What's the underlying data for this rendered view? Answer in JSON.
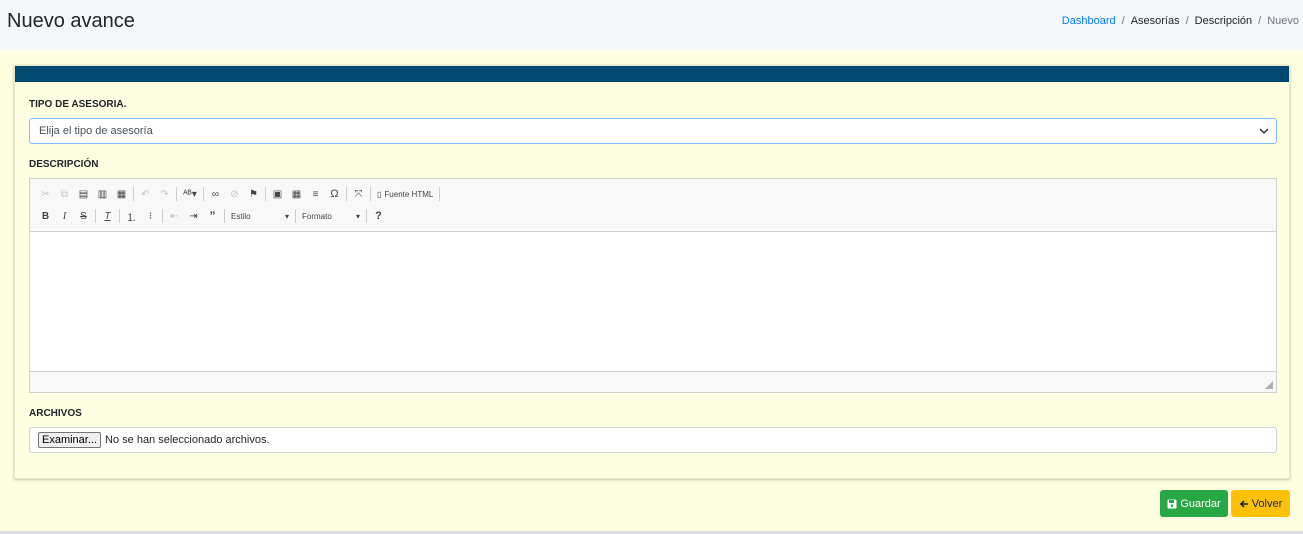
{
  "header": {
    "title": "Nuevo avance",
    "breadcrumb": [
      "Dashboard",
      "Asesorías",
      "Descripción",
      "Nuevo"
    ]
  },
  "form": {
    "tipo_label": "TIPO DE ASESORIA.",
    "tipo_select_value": "Elija el tipo de asesoría",
    "descripcion_label": "DESCRIPCIÓN",
    "archivos_label": "ARCHIVOS",
    "file_button": "Examinar...",
    "file_status": "No se han seleccionado archivos."
  },
  "editor": {
    "source_label": "Fuente HTML",
    "style_combo": "Estilo",
    "format_combo": "Formato",
    "help": "?",
    "row1_icons": [
      "cut-icon",
      "copy-icon",
      "paste-icon",
      "paste-text-icon",
      "paste-word-icon",
      "undo-icon",
      "redo-icon",
      "spellcheck-icon",
      "link-icon",
      "unlink-icon",
      "anchor-icon",
      "image-icon",
      "table-icon",
      "horizontal-rule-icon",
      "special-char-icon",
      "maximize-icon",
      "source-icon"
    ],
    "row2_icons": [
      "bold-icon",
      "italic-icon",
      "strike-icon",
      "remove-format-icon",
      "numbered-list-icon",
      "bulleted-list-icon",
      "outdent-icon",
      "indent-icon",
      "blockquote-icon",
      "help-icon"
    ]
  },
  "actions": {
    "save_label": "Guardar",
    "back_label": "Volver"
  },
  "colors": {
    "card_header": "#004a70",
    "save": "#28a745",
    "back": "#ffc107",
    "link": "#007bff"
  }
}
